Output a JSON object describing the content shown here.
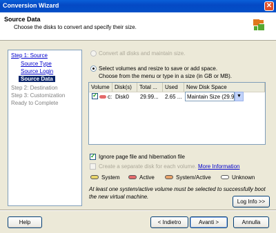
{
  "window": {
    "title": "Conversion Wizard",
    "close_glyph": "✕"
  },
  "header": {
    "title": "Source Data",
    "subtitle": "Choose the disks to convert and specify their size."
  },
  "nav": {
    "items": [
      {
        "label": "Step 1: Source",
        "state": "link"
      },
      {
        "label": "Source Type",
        "state": "link"
      },
      {
        "label": "Source Login",
        "state": "link"
      },
      {
        "label": "Source Data",
        "state": "selected"
      },
      {
        "label": "Step 2: Destination",
        "state": "disabled"
      },
      {
        "label": "Step 3: Customization",
        "state": "disabled"
      },
      {
        "label": "Ready to Complete",
        "state": "disabled"
      }
    ]
  },
  "options": {
    "convert_all": "Convert all disks and maintain size.",
    "select_volumes_line1": "Select volumes and resize to save or add space.",
    "select_volumes_line2": "Choose from the menu or type in a size (in GB or MB)."
  },
  "table": {
    "columns": [
      "Volume",
      "Disk(s)",
      "Total ...",
      "Used",
      "New Disk Space"
    ],
    "rows": [
      {
        "checked": true,
        "volume": "c:",
        "disks": "Disk0",
        "total": "29.99...",
        "used": "2.65 ...",
        "new_space": "Maintain Size (29.99 GB)"
      }
    ],
    "dropdown_arrow": "▼"
  },
  "checkboxes": {
    "ignore_pagefile": {
      "label": "Ignore page file and hibernation file",
      "checked": true
    },
    "separate_disk": {
      "label": "Create a separate disk for each volume.",
      "checked": false
    },
    "more_info": "More Information"
  },
  "legend": [
    {
      "label": "System",
      "color": "#e9d56a"
    },
    {
      "label": "Active",
      "color": "#e46a6a"
    },
    {
      "label": "System/Active",
      "color": "#e9a36a"
    },
    {
      "label": "Unknown",
      "color": "#ffffff"
    }
  ],
  "note_line1": "At least one system/active volume must be selected to successfully boot",
  "note_line2": "the new virtual machine.",
  "buttons": {
    "log_info": "Log Info >>",
    "help": "Help",
    "back": "< Indietro",
    "next": "Avanti >",
    "cancel": "Annulla"
  },
  "colors": {
    "accent": "#0a246a",
    "link": "#0000cc",
    "titlebar": "#0549c4"
  }
}
